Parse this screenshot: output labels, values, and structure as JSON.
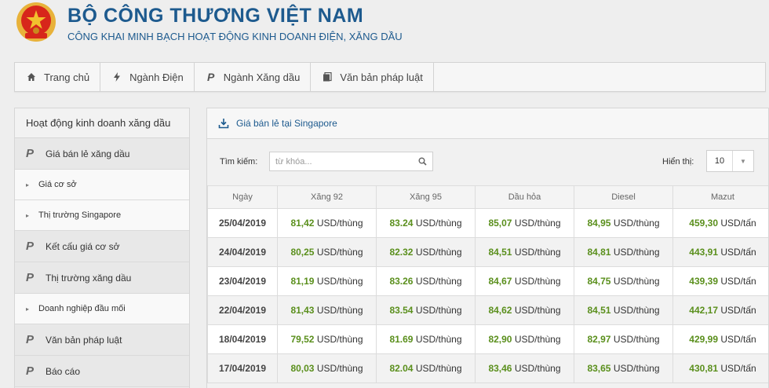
{
  "header": {
    "title": "BỘ CÔNG THƯƠNG VIỆT NAM",
    "subtitle": "CÔNG KHAI MINH BẠCH HOẠT ĐỘNG KINH DOANH ĐIỆN, XĂNG DẦU"
  },
  "topnav": [
    {
      "icon": "home-icon",
      "label": "Trang chủ"
    },
    {
      "icon": "bolt-icon",
      "label": "Ngành Điện"
    },
    {
      "icon": "p-icon",
      "label": "Ngành Xăng dầu"
    },
    {
      "icon": "document-icon",
      "label": "Văn bản pháp luật"
    }
  ],
  "sidebar": {
    "heading": "Hoạt động kinh doanh xăng dầu",
    "items": [
      {
        "type": "main",
        "label": "Giá bán lẻ xăng dầu"
      },
      {
        "type": "sub",
        "label": "Giá cơ sở"
      },
      {
        "type": "sub",
        "label": "Thị trường Singapore"
      },
      {
        "type": "main",
        "label": "Kết cấu giá cơ sở"
      },
      {
        "type": "main",
        "label": "Thị trường xăng dầu"
      },
      {
        "type": "sub",
        "label": "Doanh nghiệp đầu mối"
      },
      {
        "type": "main",
        "label": "Văn bản pháp luật"
      },
      {
        "type": "main",
        "label": "Báo cáo"
      }
    ]
  },
  "panel": {
    "title": "Giá bán lẻ tại Singapore",
    "search_label": "Tìm kiếm:",
    "search_placeholder": "từ khóa...",
    "show_label": "Hiển thị:",
    "show_value": "10"
  },
  "table": {
    "columns": [
      "Ngày",
      "Xăng 92",
      "Xăng 95",
      "Dầu hỏa",
      "Diesel",
      "Mazut"
    ],
    "rows": [
      {
        "date": "25/04/2019",
        "values": [
          "81,42",
          "83.24",
          "85,07",
          "84,95",
          "459,30"
        ]
      },
      {
        "date": "24/04/2019",
        "values": [
          "80,25",
          "82.32",
          "84,51",
          "84,81",
          "443,91"
        ]
      },
      {
        "date": "23/04/2019",
        "values": [
          "81,19",
          "83.26",
          "84,67",
          "84,75",
          "439,39"
        ]
      },
      {
        "date": "22/04/2019",
        "values": [
          "81,43",
          "83.54",
          "84,62",
          "84,51",
          "442,17"
        ]
      },
      {
        "date": "18/04/2019",
        "values": [
          "79,52",
          "81.69",
          "82,90",
          "82,97",
          "429,99"
        ]
      },
      {
        "date": "17/04/2019",
        "values": [
          "80,03",
          "82.04",
          "83,46",
          "83,65",
          "430,81"
        ]
      }
    ],
    "units": [
      "USD/thùng",
      "USD/thùng",
      "USD/thùng",
      "USD/thùng",
      "USD/tấn"
    ]
  },
  "colors": {
    "brand": "#1d5a8e",
    "value_green": "#5a8f1c",
    "emblem_red": "#d7261b",
    "emblem_gold": "#f2c12e"
  }
}
